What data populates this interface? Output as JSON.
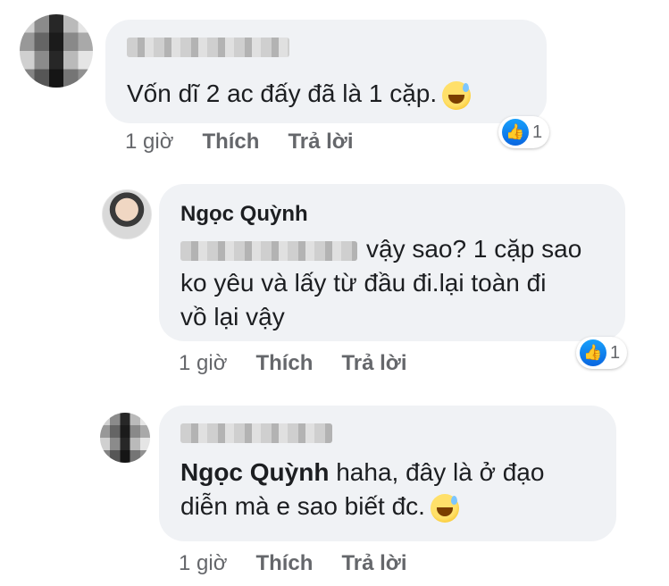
{
  "comments": [
    {
      "author_name": "",
      "text": "Vốn dĩ 2 ac đấy  đã là 1 cặp.",
      "time": "1 giờ",
      "like": "Thích",
      "reply": "Trả lời",
      "reaction_count": "1",
      "emoji_icon": "sweat-smile-icon"
    },
    {
      "author_name": "Ngọc Quỳnh",
      "text_line1": "vậy sao? 1 cặp sao",
      "text_line2": "ko yêu và lấy từ đầu đi.lại toàn đi",
      "text_line3": "vồ lại vậy",
      "time": "1 giờ",
      "like": "Thích",
      "reply": "Trả lời",
      "reaction_count": "1"
    },
    {
      "author_name": "",
      "mention": "Ngọc Quỳnh",
      "text_line1": "haha, đây là ở đạo",
      "text_line2": "diễn mà e sao biết đc.",
      "time": "1 giờ",
      "like": "Thích",
      "reply": "Trả lời",
      "emoji_icon": "sweat-smile-icon"
    }
  ],
  "colors": {
    "bubble": "#f0f2f5",
    "meta_text": "#65676b",
    "like_blue": "#1877f2"
  }
}
